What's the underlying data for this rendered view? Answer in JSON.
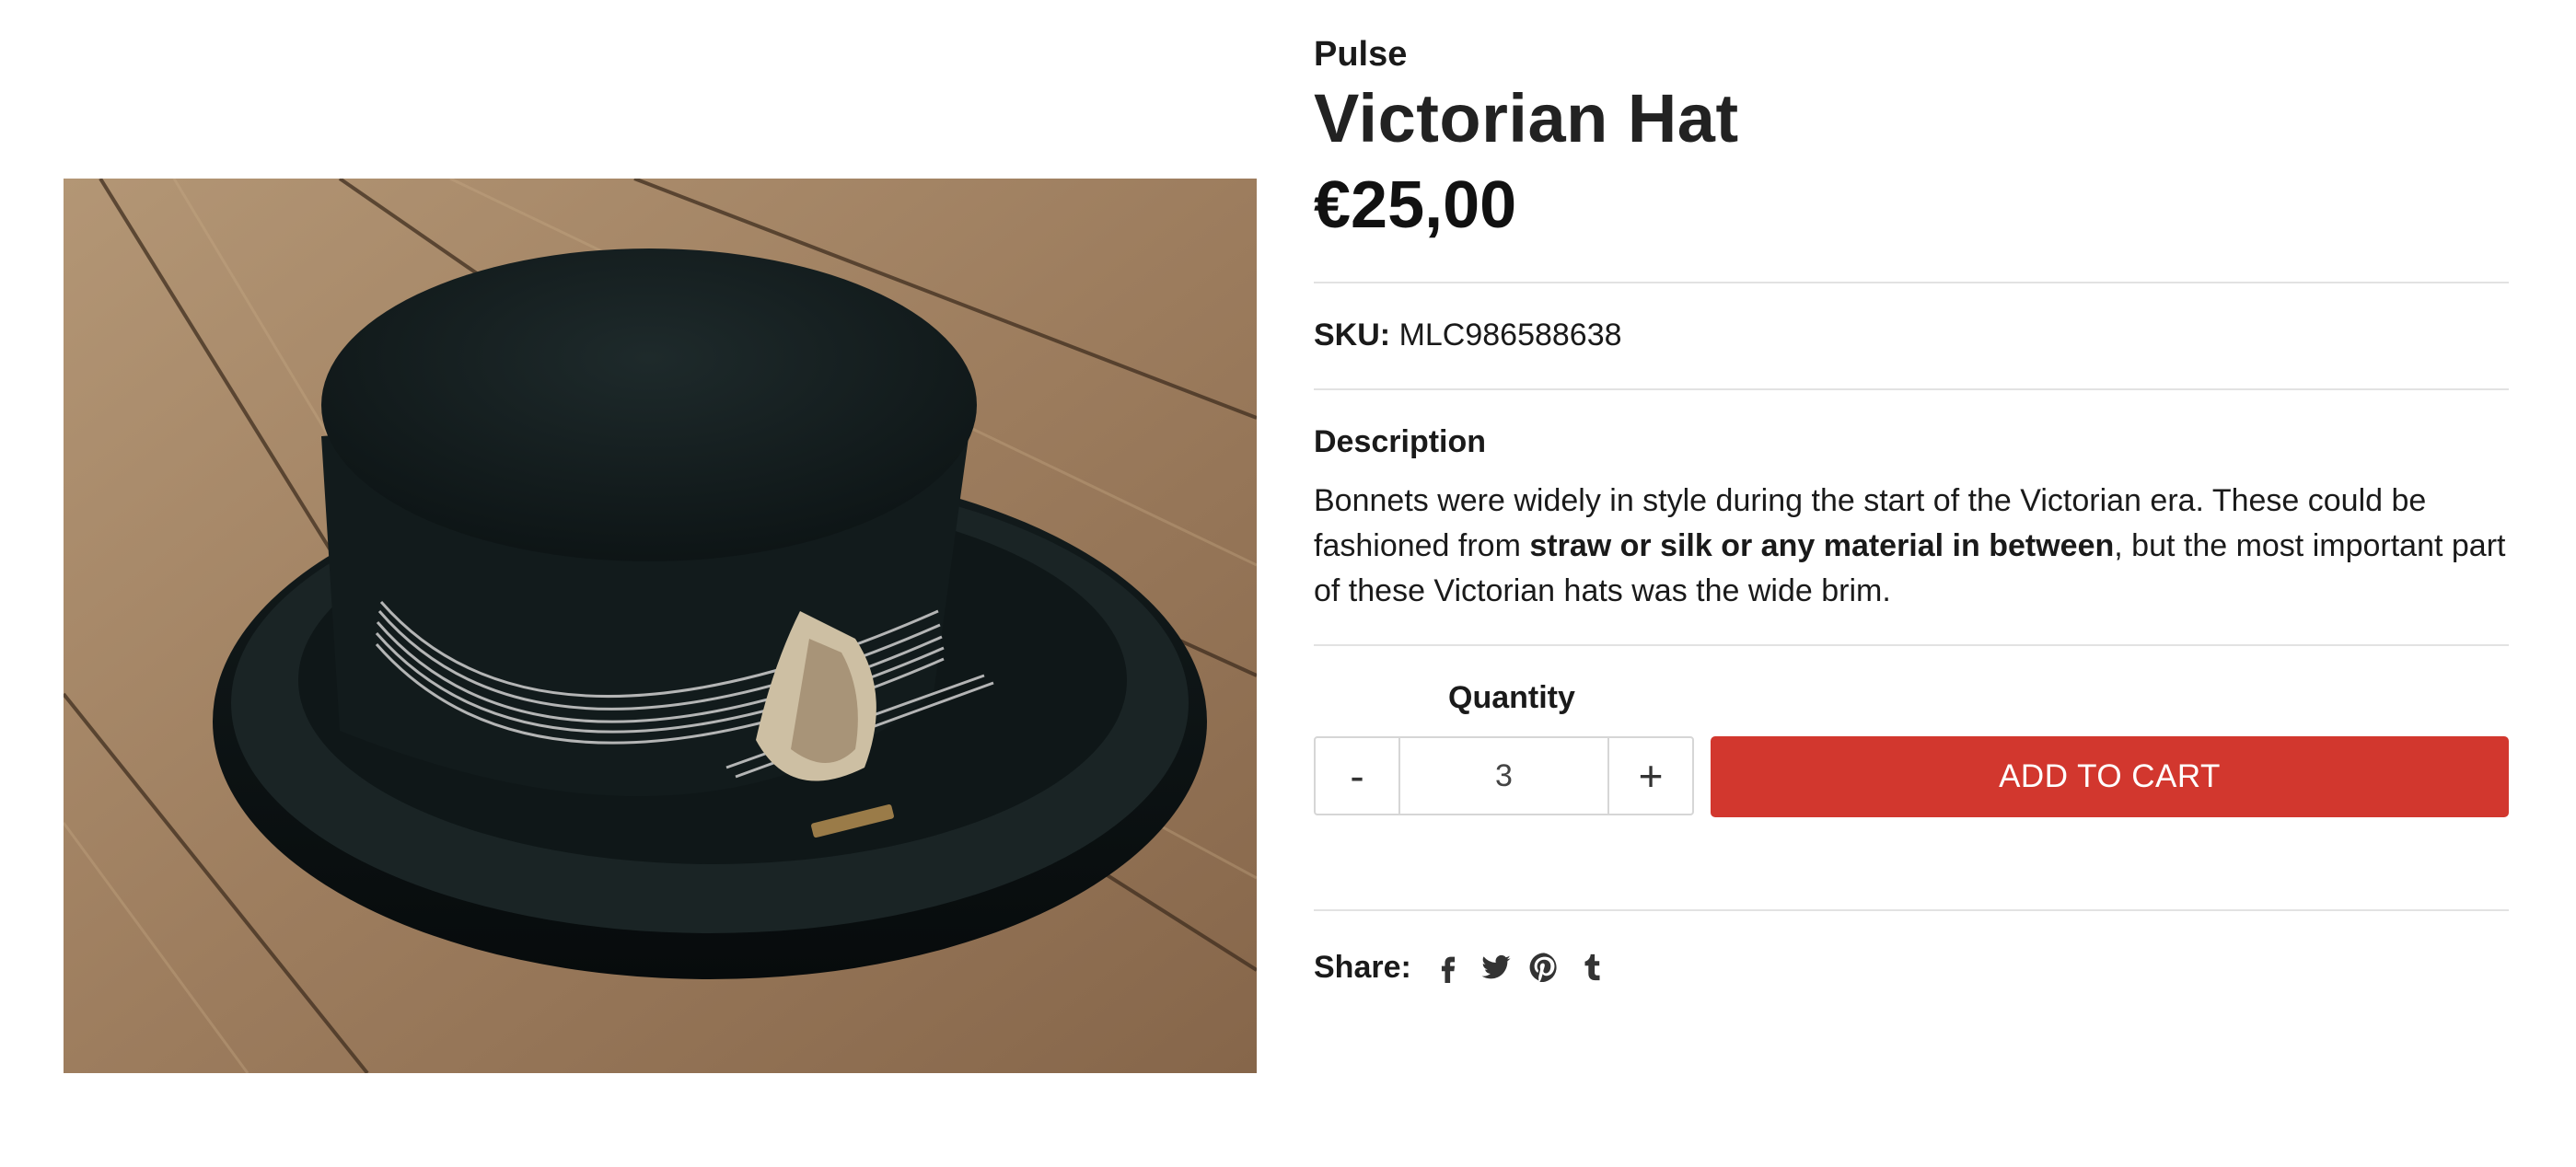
{
  "product": {
    "vendor": "Pulse",
    "title": "Victorian Hat",
    "price": "€25,00",
    "sku_label": "SKU:",
    "sku_value": "MLC986588638",
    "image_alt": "Black felt Victorian top hat with silver wire band and shell ornament on wooden floor"
  },
  "description": {
    "heading": "Description",
    "text_before": "Bonnets were widely in style during the start of the Victorian era. These could be fashioned from ",
    "text_bold": "straw or silk or any material in between",
    "text_after": ", but the most important part of these Victorian hats was the wide brim."
  },
  "purchase": {
    "quantity_label": "Quantity",
    "minus_label": "-",
    "plus_label": "+",
    "quantity_value": "3",
    "add_to_cart_label": "ADD TO CART"
  },
  "share": {
    "label": "Share:",
    "icons": [
      "facebook-icon",
      "twitter-icon",
      "pinterest-icon",
      "tumblr-icon"
    ]
  },
  "colors": {
    "accent": "#d2372e",
    "text": "#1a1a1a",
    "divider": "#e2e2e2"
  }
}
